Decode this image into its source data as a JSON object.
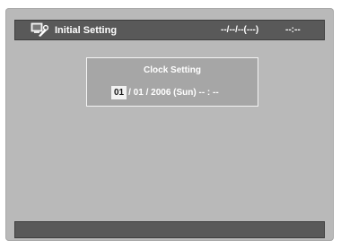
{
  "title_bar": {
    "icon": "settings-screen-icon",
    "title": "Initial Setting",
    "date": "--/--/--(---)",
    "time": "--:--"
  },
  "clock_setting": {
    "title": "Clock Setting",
    "month": "01",
    "rest": "/ 01 / 2006 (Sun)   -- : --"
  },
  "colors": {
    "background": "#b9b9b9",
    "bar": "#595959",
    "panel": "#a6a6a6",
    "highlight": "#f2f2f2",
    "text": "#ffffff"
  }
}
